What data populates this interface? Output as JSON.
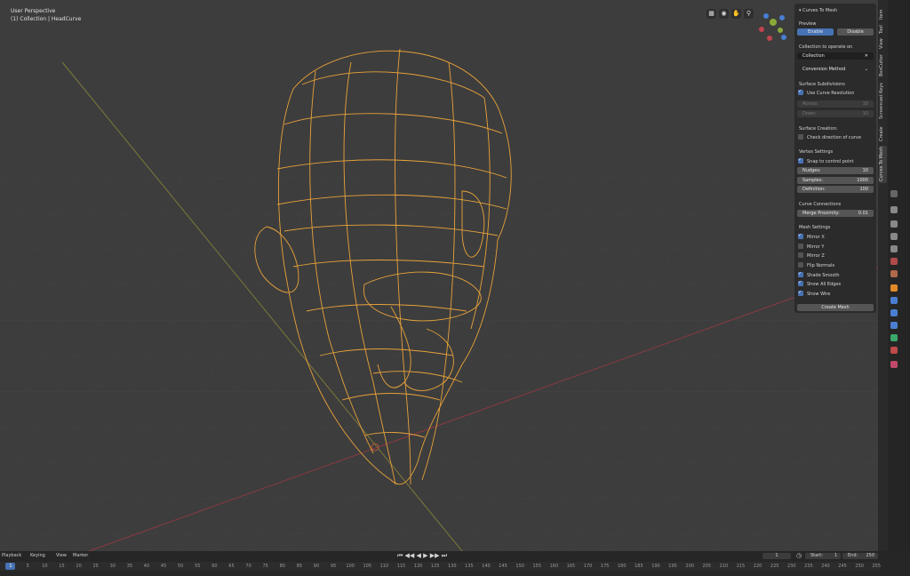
{
  "viewport": {
    "perspective_label": "User Perspective",
    "collection_label": "(1) Collection | HeadCurve"
  },
  "panel": {
    "title": "Curves To Mesh",
    "preview_label": "Preview",
    "enable_label": "Enable",
    "disable_label": "Disable",
    "collection_operate_label": "Collection to operate on",
    "collection_value": "Collection",
    "conversion_method_label": "Conversion Method",
    "surface_subdivisions_label": "Surface Subdivisions",
    "use_curve_resolution_label": "Use Curve Resolution",
    "across_label": "Across:",
    "across_value": "10",
    "down_label": "Down:",
    "down_value": "10",
    "surface_creation_label": "Surface Creation:",
    "check_direction_label": "Check direction of curve",
    "vertex_settings_label": "Vertex Settings",
    "snap_control_label": "Snap to control point",
    "nudges_label": "Nudges:",
    "nudges_value": "10",
    "samples_label": "Samples:",
    "samples_value": "1000",
    "definition_label": "Definition:",
    "definition_value": "100",
    "curve_connections_label": "Curve Connections",
    "merge_proximity_label": "Merge Proximity:",
    "merge_proximity_value": "0.01",
    "mesh_settings_label": "Mesh Settings",
    "mesh_checks": [
      {
        "label": "Mirror X",
        "checked": true
      },
      {
        "label": "Mirror Y",
        "checked": false
      },
      {
        "label": "Mirror Z",
        "checked": false
      },
      {
        "label": "Flip Normals",
        "checked": false
      },
      {
        "label": "Shade Smooth",
        "checked": true
      },
      {
        "label": "Show All Edges",
        "checked": true
      },
      {
        "label": "Show Wire",
        "checked": true
      }
    ],
    "create_mesh_label": "Create Mesh"
  },
  "side_tabs": [
    "Item",
    "Tool",
    "View",
    "BoxCutter",
    "Screencast Keys",
    "Create",
    "Curves To Mesh"
  ],
  "timeline": {
    "menus": [
      "Playback",
      "Keying",
      "View",
      "Marker"
    ],
    "current_frame": "1",
    "start_label": "Start:",
    "start_value": "1",
    "end_label": "End:",
    "end_value": "250",
    "frame_numbers": [
      "1",
      "5",
      "10",
      "15",
      "20",
      "25",
      "30",
      "35",
      "40",
      "45",
      "50",
      "55",
      "60",
      "65",
      "70",
      "75",
      "80",
      "85",
      "90",
      "95",
      "100",
      "105",
      "110",
      "115",
      "120",
      "125",
      "130",
      "135",
      "140",
      "145",
      "150",
      "155",
      "160",
      "165",
      "170",
      "175",
      "180",
      "185",
      "190",
      "195",
      "200",
      "205",
      "210",
      "215",
      "220",
      "225",
      "230",
      "235",
      "240",
      "245",
      "250",
      "255"
    ]
  },
  "colors": {
    "wire": "#e8a23a",
    "accent": "#4772b3",
    "x_axis": "#c0444f",
    "y_axis": "#8aa838"
  }
}
